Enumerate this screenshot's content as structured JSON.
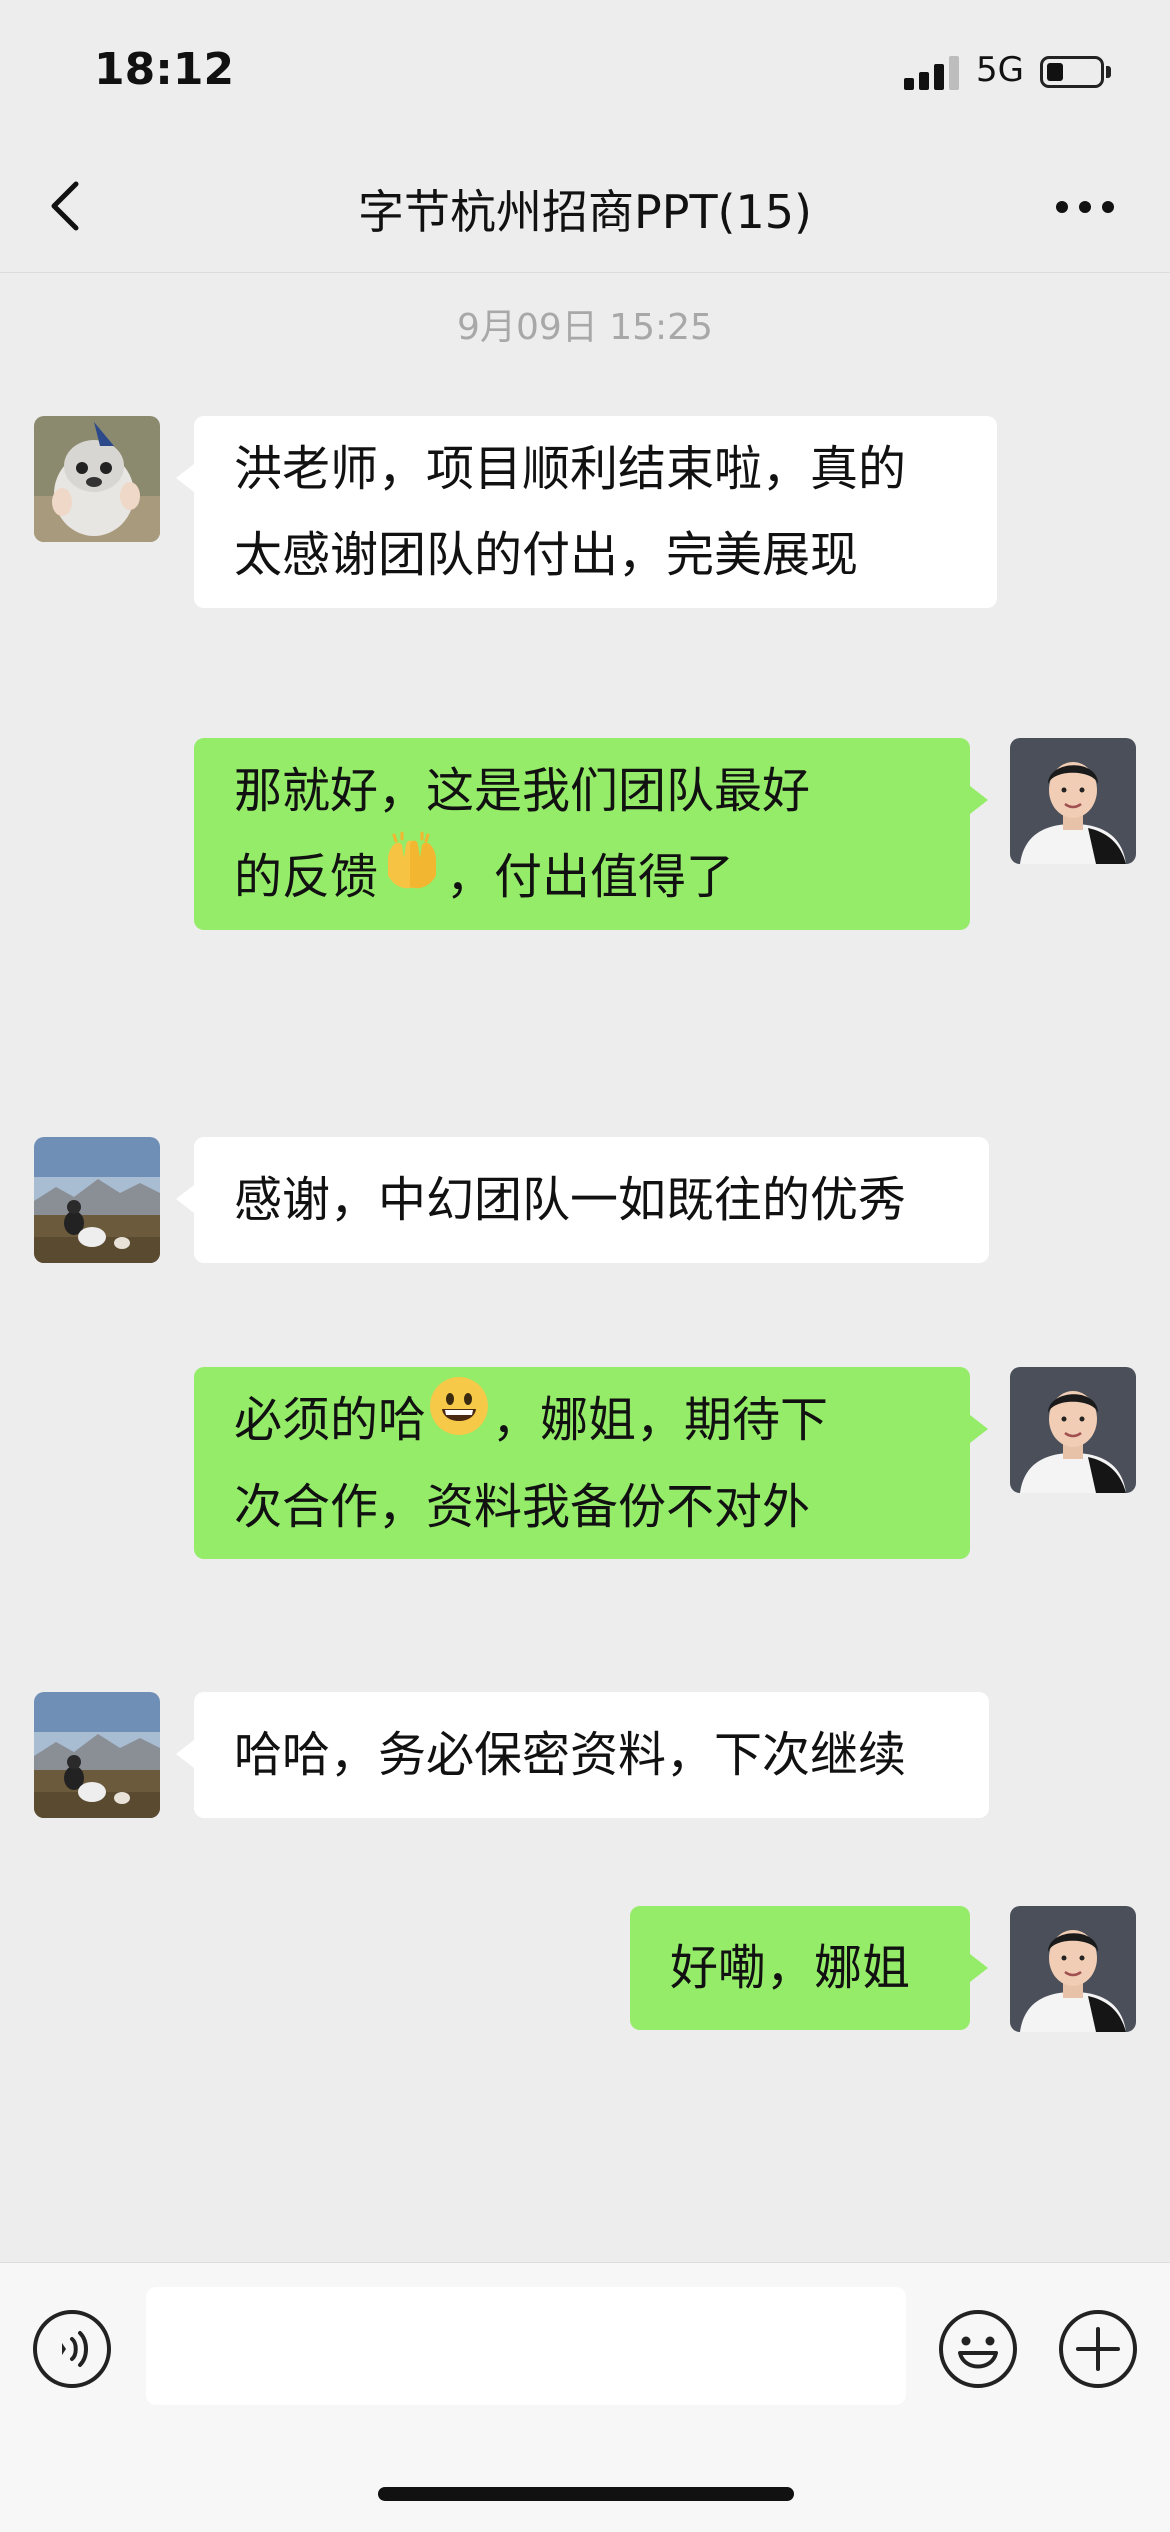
{
  "status_bar": {
    "time": "18:12",
    "network": "5G",
    "signal_bars_active": 3,
    "battery_level": 0.3
  },
  "header": {
    "title": "字节杭州招商PPT(15)",
    "back_icon": "chevron-left-icon",
    "more_icon": "ellipsis-icon"
  },
  "timestamp": "9月09日 15:25",
  "messages": [
    {
      "side": "in",
      "avatar": "penguin-avatar",
      "lines": [
        "洪老师，项目顺利结束啦，真的",
        "太感谢团队的付出，完美展现"
      ]
    },
    {
      "side": "out",
      "avatar": "man-portrait-avatar",
      "lines": [
        "那就好，这是我们团队最好",
        "的反馈",
        "，付出值得了"
      ],
      "emoji": "raised-hands-emoji"
    },
    {
      "side": "in",
      "avatar": "mountain-landscape-avatar",
      "lines": [
        "感谢，中幻团队一如既往的优秀"
      ]
    },
    {
      "side": "out",
      "avatar": "man-portrait-avatar",
      "lines": [
        "必须的哈",
        "，娜姐，期待下",
        "次合作，资料我备份不对外"
      ],
      "emoji": "grinning-face-emoji"
    },
    {
      "side": "in",
      "avatar": "mountain-landscape-avatar",
      "lines": [
        "哈哈，务必保密资料，下次继续"
      ]
    },
    {
      "side": "out",
      "avatar": "man-portrait-avatar",
      "lines": [
        "好嘞，娜姐"
      ]
    }
  ],
  "input_bar": {
    "voice_icon": "voice-icon",
    "input_value": "",
    "emoji_icon": "smiley-icon",
    "plus_icon": "plus-icon"
  },
  "colors": {
    "background": "#ededed",
    "outgoing_bubble": "#95ec69",
    "incoming_bubble": "#ffffff",
    "timestamp_text": "#a8a8a8"
  }
}
